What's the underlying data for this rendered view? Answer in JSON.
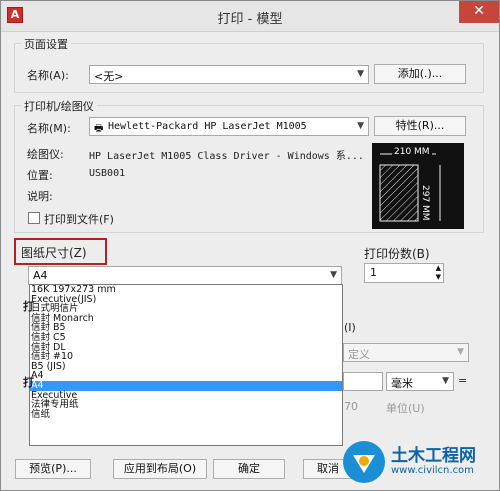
{
  "window": {
    "title": "打印 - 模型",
    "close_glyph": "✕",
    "app_icon_glyph": "A"
  },
  "page_setup": {
    "group_label": "页面设置",
    "name_label": "名称(A):",
    "name_value": "<无>",
    "add_button": "添加(.)..."
  },
  "printer": {
    "group_label": "打印机/绘图仪",
    "name_label": "名称(M):",
    "name_value": "Hewlett-Packard HP LaserJet M1005",
    "properties_button": "特性(R)...",
    "plotter_label": "绘图仪:",
    "plotter_value": "HP LaserJet M1005 Class Driver - Windows 系...",
    "location_label": "位置:",
    "location_value": "USB001",
    "description_label": "说明:",
    "print_to_file_label": "打印到文件(F)",
    "preview_width": "210 MM",
    "preview_height": "297 MM"
  },
  "paper_size": {
    "label": "图纸尺寸(Z)",
    "selected": "A4",
    "options": [
      "16K 197x273 mm",
      "Executive(JIS)",
      "日式明信片",
      "信封 Monarch",
      "信封 B5",
      "信封 C5",
      "信封 DL",
      "信封 #10",
      "B5 (JIS)",
      "A4",
      "A4",
      "Executive",
      "法律专用纸",
      "信纸"
    ],
    "selected_option_index": 10
  },
  "copies": {
    "label": "打印份数(B)",
    "value": "1"
  },
  "partial": {
    "scale_label_fragment": "(I)",
    "custom_fragment": "定义",
    "unit_value": "毫米",
    "equals": "=",
    "number_fragment": "70",
    "unit_label": "单位(U)"
  },
  "buttons": {
    "preview": "预览(P)...",
    "apply_layout": "应用到布局(O)",
    "ok": "确定",
    "cancel": "取消"
  },
  "watermark": {
    "cn": "土木工程网",
    "url": "www.civilcn.com"
  }
}
